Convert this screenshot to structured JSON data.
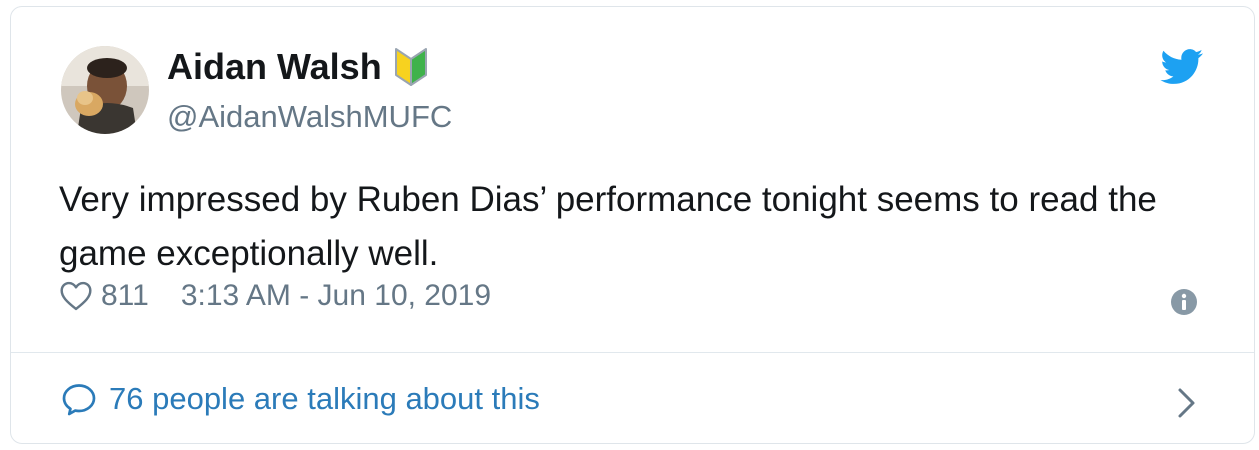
{
  "user": {
    "display_name": "Aidan Walsh",
    "handle": "@AidanWalshMUFC",
    "badge_icon": "beginner-badge-icon",
    "avatar": "avatar-photo"
  },
  "tweet": {
    "text": "Very impressed by Ruben Dias’ performance tonight seems to read the game exceptionally well.",
    "like_count": "811",
    "timestamp": "3:13 AM - Jun 10, 2019"
  },
  "conversation": {
    "label": "76 people are talking about this"
  },
  "icons": {
    "brand": "twitter-bird-icon",
    "like": "heart-icon",
    "info": "info-icon",
    "reply": "speech-bubble-icon",
    "navigate": "chevron-right-icon"
  },
  "colors": {
    "twitter_blue": "#1da1f2",
    "link_blue": "#2b7bb9",
    "text_primary": "#14171a",
    "text_secondary": "#657786",
    "badge_green": "#3fb24b",
    "badge_yellow": "#f7d21f"
  }
}
